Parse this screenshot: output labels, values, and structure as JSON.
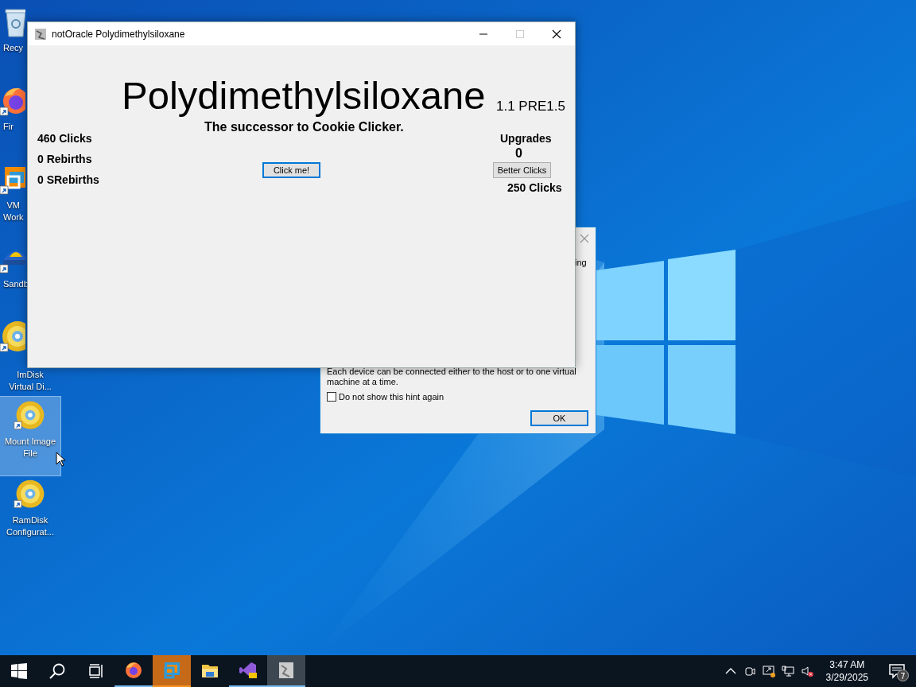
{
  "desktop": {
    "icons": [
      {
        "kind": "recycle-bin",
        "lines": [
          "Recy"
        ],
        "selected": false
      },
      {
        "kind": "firefox",
        "lines": [
          "Fir"
        ],
        "selected": false
      },
      {
        "kind": "vmware",
        "lines": [
          "VM",
          "Work"
        ],
        "selected": false
      },
      {
        "kind": "sandbox",
        "lines": [
          "Sandb"
        ],
        "selected": false
      },
      {
        "kind": "disc",
        "lines": [
          "ImDisk",
          "Virtual Di..."
        ],
        "selected": false
      },
      {
        "kind": "disc",
        "lines": [
          "Mount Image",
          "File"
        ],
        "selected": true
      },
      {
        "kind": "disc",
        "lines": [
          "RamDisk",
          "Configurat..."
        ],
        "selected": false
      }
    ]
  },
  "hint_dialog": {
    "fragment": "ing",
    "message": "Each device can be connected either to the host or to one virtual machine at a time.",
    "checkbox": {
      "label": "Do not show this hint again",
      "checked": false
    },
    "ok": "OK"
  },
  "window": {
    "title": "notOracle Polydimethylsiloxane",
    "heading": "Polydimethylsiloxane",
    "version": "1.1 PRE1.5",
    "tagline": "The successor to Cookie Clicker.",
    "stats": [
      "460 Clicks",
      "0 Rebirths",
      "0 SRebirths"
    ],
    "click_button": "Click me!",
    "upgrades": {
      "title": "Upgrades",
      "count": "0",
      "button": "Better Clicks",
      "cost": "250 Clicks"
    }
  },
  "taskbar": {
    "apps": [
      {
        "kind": "firefox",
        "running": true,
        "attention": false,
        "selected": false
      },
      {
        "kind": "vmware",
        "running": true,
        "attention": true,
        "selected": false
      },
      {
        "kind": "explorer",
        "running": false,
        "attention": false,
        "selected": false
      },
      {
        "kind": "visual-studio",
        "running": true,
        "attention": false,
        "selected": false
      },
      {
        "kind": "notoracle",
        "running": true,
        "attention": false,
        "selected": true
      }
    ],
    "tray": {
      "time": "3:47 AM",
      "date": "3/29/2025",
      "notifications": "7"
    }
  }
}
